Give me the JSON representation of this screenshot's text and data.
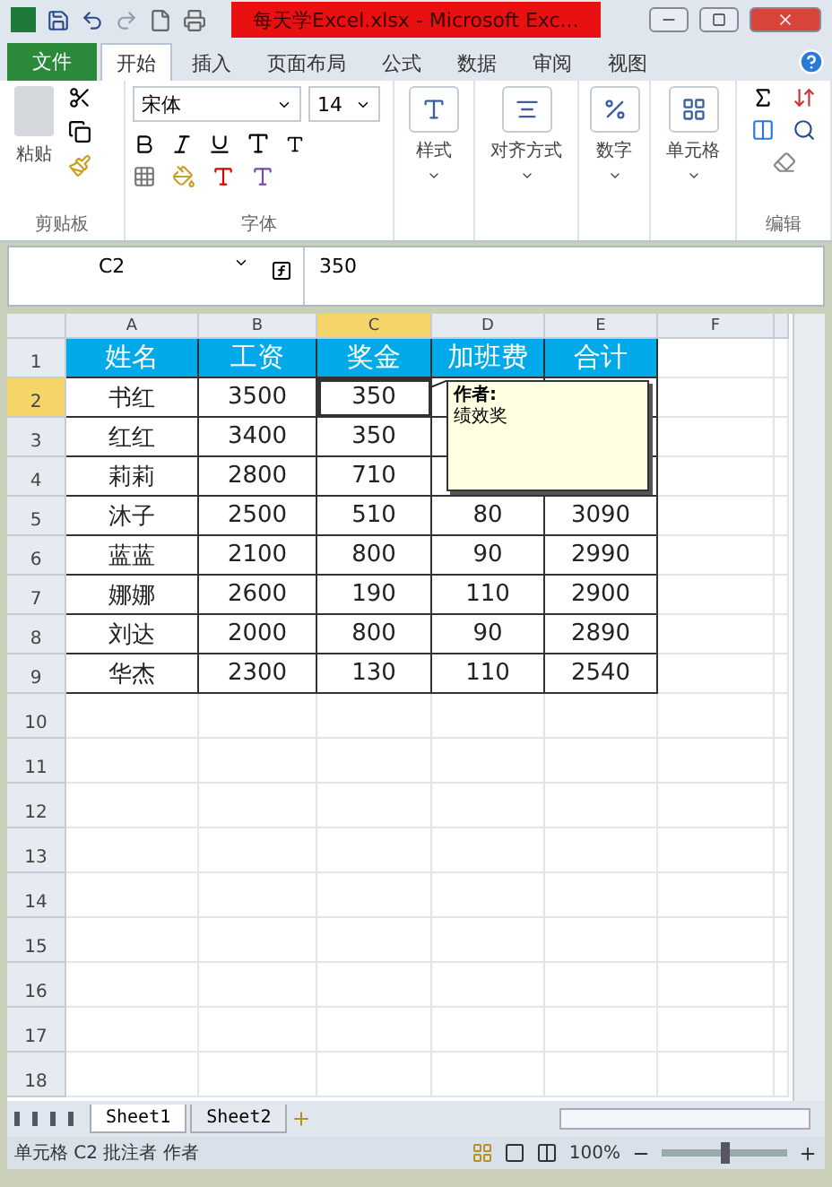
{
  "window": {
    "title": "每天学Excel.xlsx - Microsoft Exc..."
  },
  "file_tab": "文件",
  "tabs": [
    {
      "label": "开始",
      "selected": true
    },
    {
      "label": "插入",
      "selected": false
    },
    {
      "label": "页面布局",
      "selected": false
    },
    {
      "label": "公式",
      "selected": false
    },
    {
      "label": "数据",
      "selected": false
    },
    {
      "label": "审阅",
      "selected": false
    },
    {
      "label": "视图",
      "selected": false
    }
  ],
  "ribbon": {
    "paste": "粘贴",
    "clipboard_label": "剪贴板",
    "font_name": "宋体",
    "font_size": "14",
    "font_label": "字体",
    "big_buttons": [
      "样式",
      "对齐方式",
      "数字",
      "单元格"
    ],
    "editing_label": "编辑"
  },
  "name_box": "C2",
  "formula": "350",
  "columns": [
    {
      "label": "A",
      "selected": false
    },
    {
      "label": "B",
      "selected": false
    },
    {
      "label": "C",
      "selected": true
    },
    {
      "label": "D",
      "selected": false
    },
    {
      "label": "E",
      "selected": false
    },
    {
      "label": "F",
      "selected": false
    }
  ],
  "rows": [
    {
      "number": "1",
      "selected": false,
      "kind": "header",
      "cells": [
        "姓名",
        "工资",
        "奖金",
        "加班费",
        "合计"
      ]
    },
    {
      "number": "2",
      "selected": true,
      "kind": "data",
      "cells": [
        "书红",
        "3500",
        "350"
      ]
    },
    {
      "number": "3",
      "selected": false,
      "kind": "data",
      "cells": [
        "红红",
        "3400",
        "350"
      ]
    },
    {
      "number": "4",
      "selected": false,
      "kind": "data",
      "cells": [
        "莉莉",
        "2800",
        "710"
      ]
    },
    {
      "number": "5",
      "selected": false,
      "kind": "data",
      "cells": [
        "沐子",
        "2500",
        "510",
        "80",
        "3090"
      ]
    },
    {
      "number": "6",
      "selected": false,
      "kind": "data",
      "cells": [
        "蓝蓝",
        "2100",
        "800",
        "90",
        "2990"
      ]
    },
    {
      "number": "7",
      "selected": false,
      "kind": "data",
      "cells": [
        "娜娜",
        "2600",
        "190",
        "110",
        "2900"
      ]
    },
    {
      "number": "8",
      "selected": false,
      "kind": "data",
      "cells": [
        "刘达",
        "2000",
        "800",
        "90",
        "2890"
      ]
    },
    {
      "number": "9",
      "selected": false,
      "kind": "data",
      "cells": [
        "华杰",
        "2300",
        "130",
        "110",
        "2540"
      ]
    },
    {
      "number": "10",
      "selected": false,
      "kind": "empty"
    },
    {
      "number": "11",
      "selected": false,
      "kind": "empty"
    },
    {
      "number": "12",
      "selected": false,
      "kind": "empty"
    },
    {
      "number": "13",
      "selected": false,
      "kind": "empty"
    },
    {
      "number": "14",
      "selected": false,
      "kind": "empty"
    },
    {
      "number": "15",
      "selected": false,
      "kind": "empty"
    },
    {
      "number": "16",
      "selected": false,
      "kind": "empty"
    },
    {
      "number": "17",
      "selected": false,
      "kind": "empty"
    },
    {
      "number": "18",
      "selected": false,
      "kind": "empty"
    }
  ],
  "comment": {
    "author": "作者:",
    "text": "绩效奖"
  },
  "sheet_tabs": [
    {
      "label": "Sheet1",
      "selected": true
    },
    {
      "label": "Sheet2",
      "selected": false
    }
  ],
  "status_bar": {
    "text": "单元格 C2 批注者 作者",
    "zoom": "100%",
    "zoom_slider": {
      "level": 0.5
    }
  }
}
